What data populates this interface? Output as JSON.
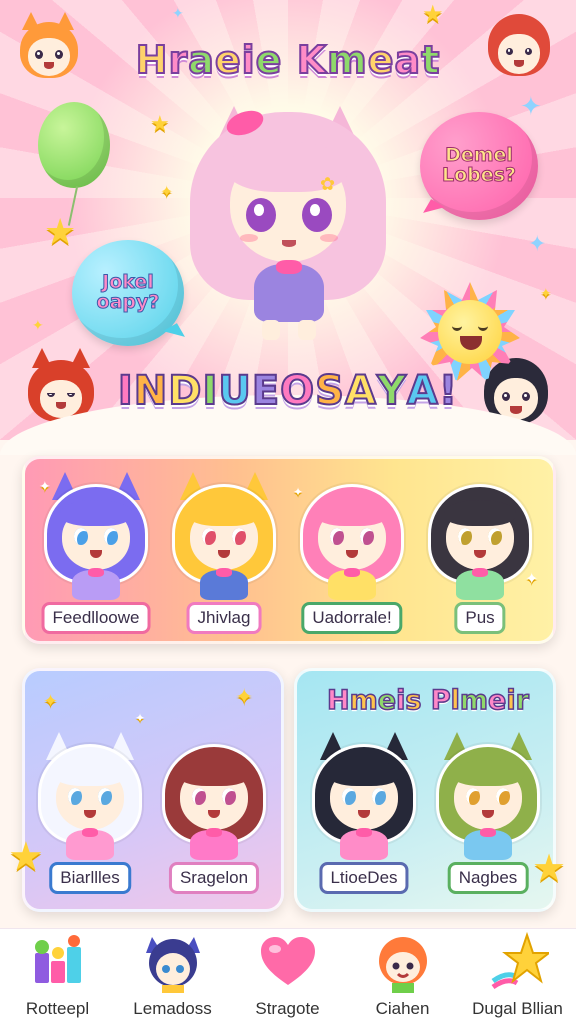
{
  "app": {
    "title": "Hraeie Kmeat",
    "subtitle": "INDIUEOSAYA!"
  },
  "bubbles": {
    "pink": "Demel Lobes?",
    "blue": "Jokel oapy?"
  },
  "featured": {
    "cards": [
      {
        "label": "Feedlloowe",
        "hair": "#7b6cf0",
        "border": "#f06aa0",
        "outfit": "#b99cf5",
        "eyes": "#4aa0e8",
        "ears": true
      },
      {
        "label": "Jhivlag",
        "hair": "#ffc83a",
        "border": "#f07ac0",
        "outfit": "#5a7ad8",
        "eyes": "#e0506a",
        "ears": true
      },
      {
        "label": "Uadorrale!",
        "hair": "#ff80b8",
        "border": "#4aa86a",
        "outfit": "#ffe066",
        "eyes": "#c05090",
        "ears": false
      },
      {
        "label": "Pus",
        "hair": "#3a3540",
        "border": "#7ac07a",
        "outfit": "#8fe0a0",
        "eyes": "#c0a030",
        "ears": false
      }
    ]
  },
  "left_panel": {
    "cards": [
      {
        "label": "Biarllles",
        "hair": "#f4f6ff",
        "border": "#3a7ad0",
        "outfit": "#ff9ad0",
        "eyes": "#5aa8e0",
        "ears": true
      },
      {
        "label": "Sragelon",
        "hair": "#9a3a3a",
        "border": "#e080c0",
        "outfit": "#ff7ac8",
        "eyes": "#c05090",
        "ears": false
      }
    ]
  },
  "right_panel": {
    "heading": "Hmeis Plmeir",
    "cards": [
      {
        "label": "LtioeDes",
        "hair": "#262838",
        "border": "#5a6ab0",
        "outfit": "#ff8cc8",
        "eyes": "#5aa8e0",
        "ears": true
      },
      {
        "label": "Nagbes",
        "hair": "#8fb04a",
        "border": "#5ab060",
        "outfit": "#7ac8f0",
        "eyes": "#e0a030",
        "ears": true
      }
    ]
  },
  "nav": {
    "items": [
      {
        "label": "Rotteepl",
        "icon": "blocks-icon"
      },
      {
        "label": "Lemadoss",
        "icon": "cat-girl-icon"
      },
      {
        "label": "Stragote",
        "icon": "heart-icon"
      },
      {
        "label": "Ciahen",
        "icon": "fox-boy-icon"
      },
      {
        "label": "Dugal Bllian",
        "icon": "rainbow-star-icon"
      }
    ]
  },
  "colors": {
    "accent_pink": "#ff5ca8",
    "accent_yellow": "#ffd23a",
    "accent_blue": "#4ed0e8"
  }
}
